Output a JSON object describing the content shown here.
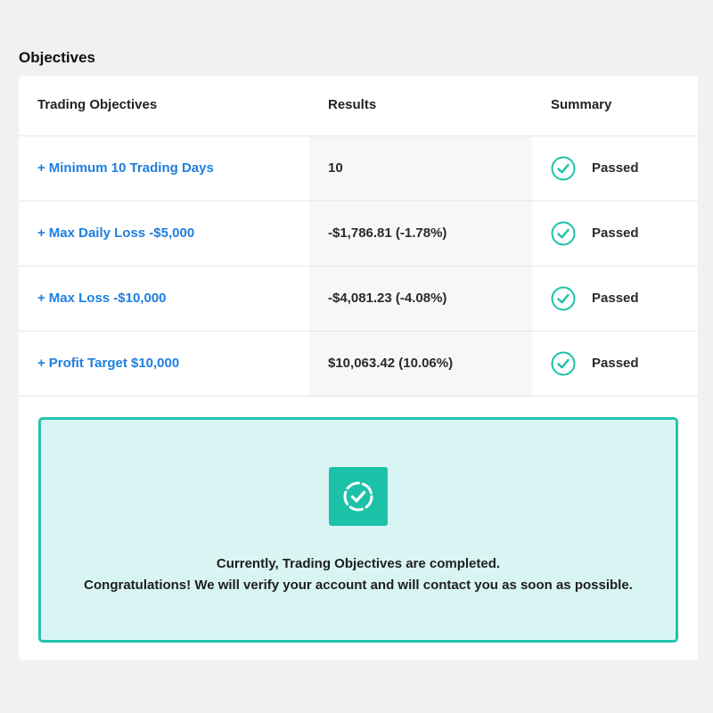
{
  "section_title": "Objectives",
  "table": {
    "headers": {
      "objectives": "Trading Objectives",
      "results": "Results",
      "summary": "Summary"
    },
    "rows": [
      {
        "plus": "+",
        "objective": "Minimum 10 Trading Days",
        "result": "10",
        "summary": "Passed"
      },
      {
        "plus": "+",
        "objective": "Max Daily Loss -$5,000",
        "result": "-$1,786.81 (-1.78%)",
        "summary": "Passed"
      },
      {
        "plus": "+",
        "objective": "Max Loss -$10,000",
        "result": "-$4,081.23 (-4.08%)",
        "summary": "Passed"
      },
      {
        "plus": "+",
        "objective": "Profit Target $10,000",
        "result": "$10,063.42 (10.06%)",
        "summary": "Passed"
      }
    ]
  },
  "banner": {
    "line1": "Currently, Trading Objectives are completed.",
    "line2": "Congratulations! We will verify your account and will contact you as soon as possible."
  },
  "colors": {
    "link": "#1e7fe0",
    "accent": "#1cc2a8",
    "banner_bg": "#d8f5f3",
    "banner_border": "#23c4ac"
  },
  "icons": {
    "row_status": "check-circle-icon",
    "banner_badge": "dashed-check-circle-icon"
  }
}
